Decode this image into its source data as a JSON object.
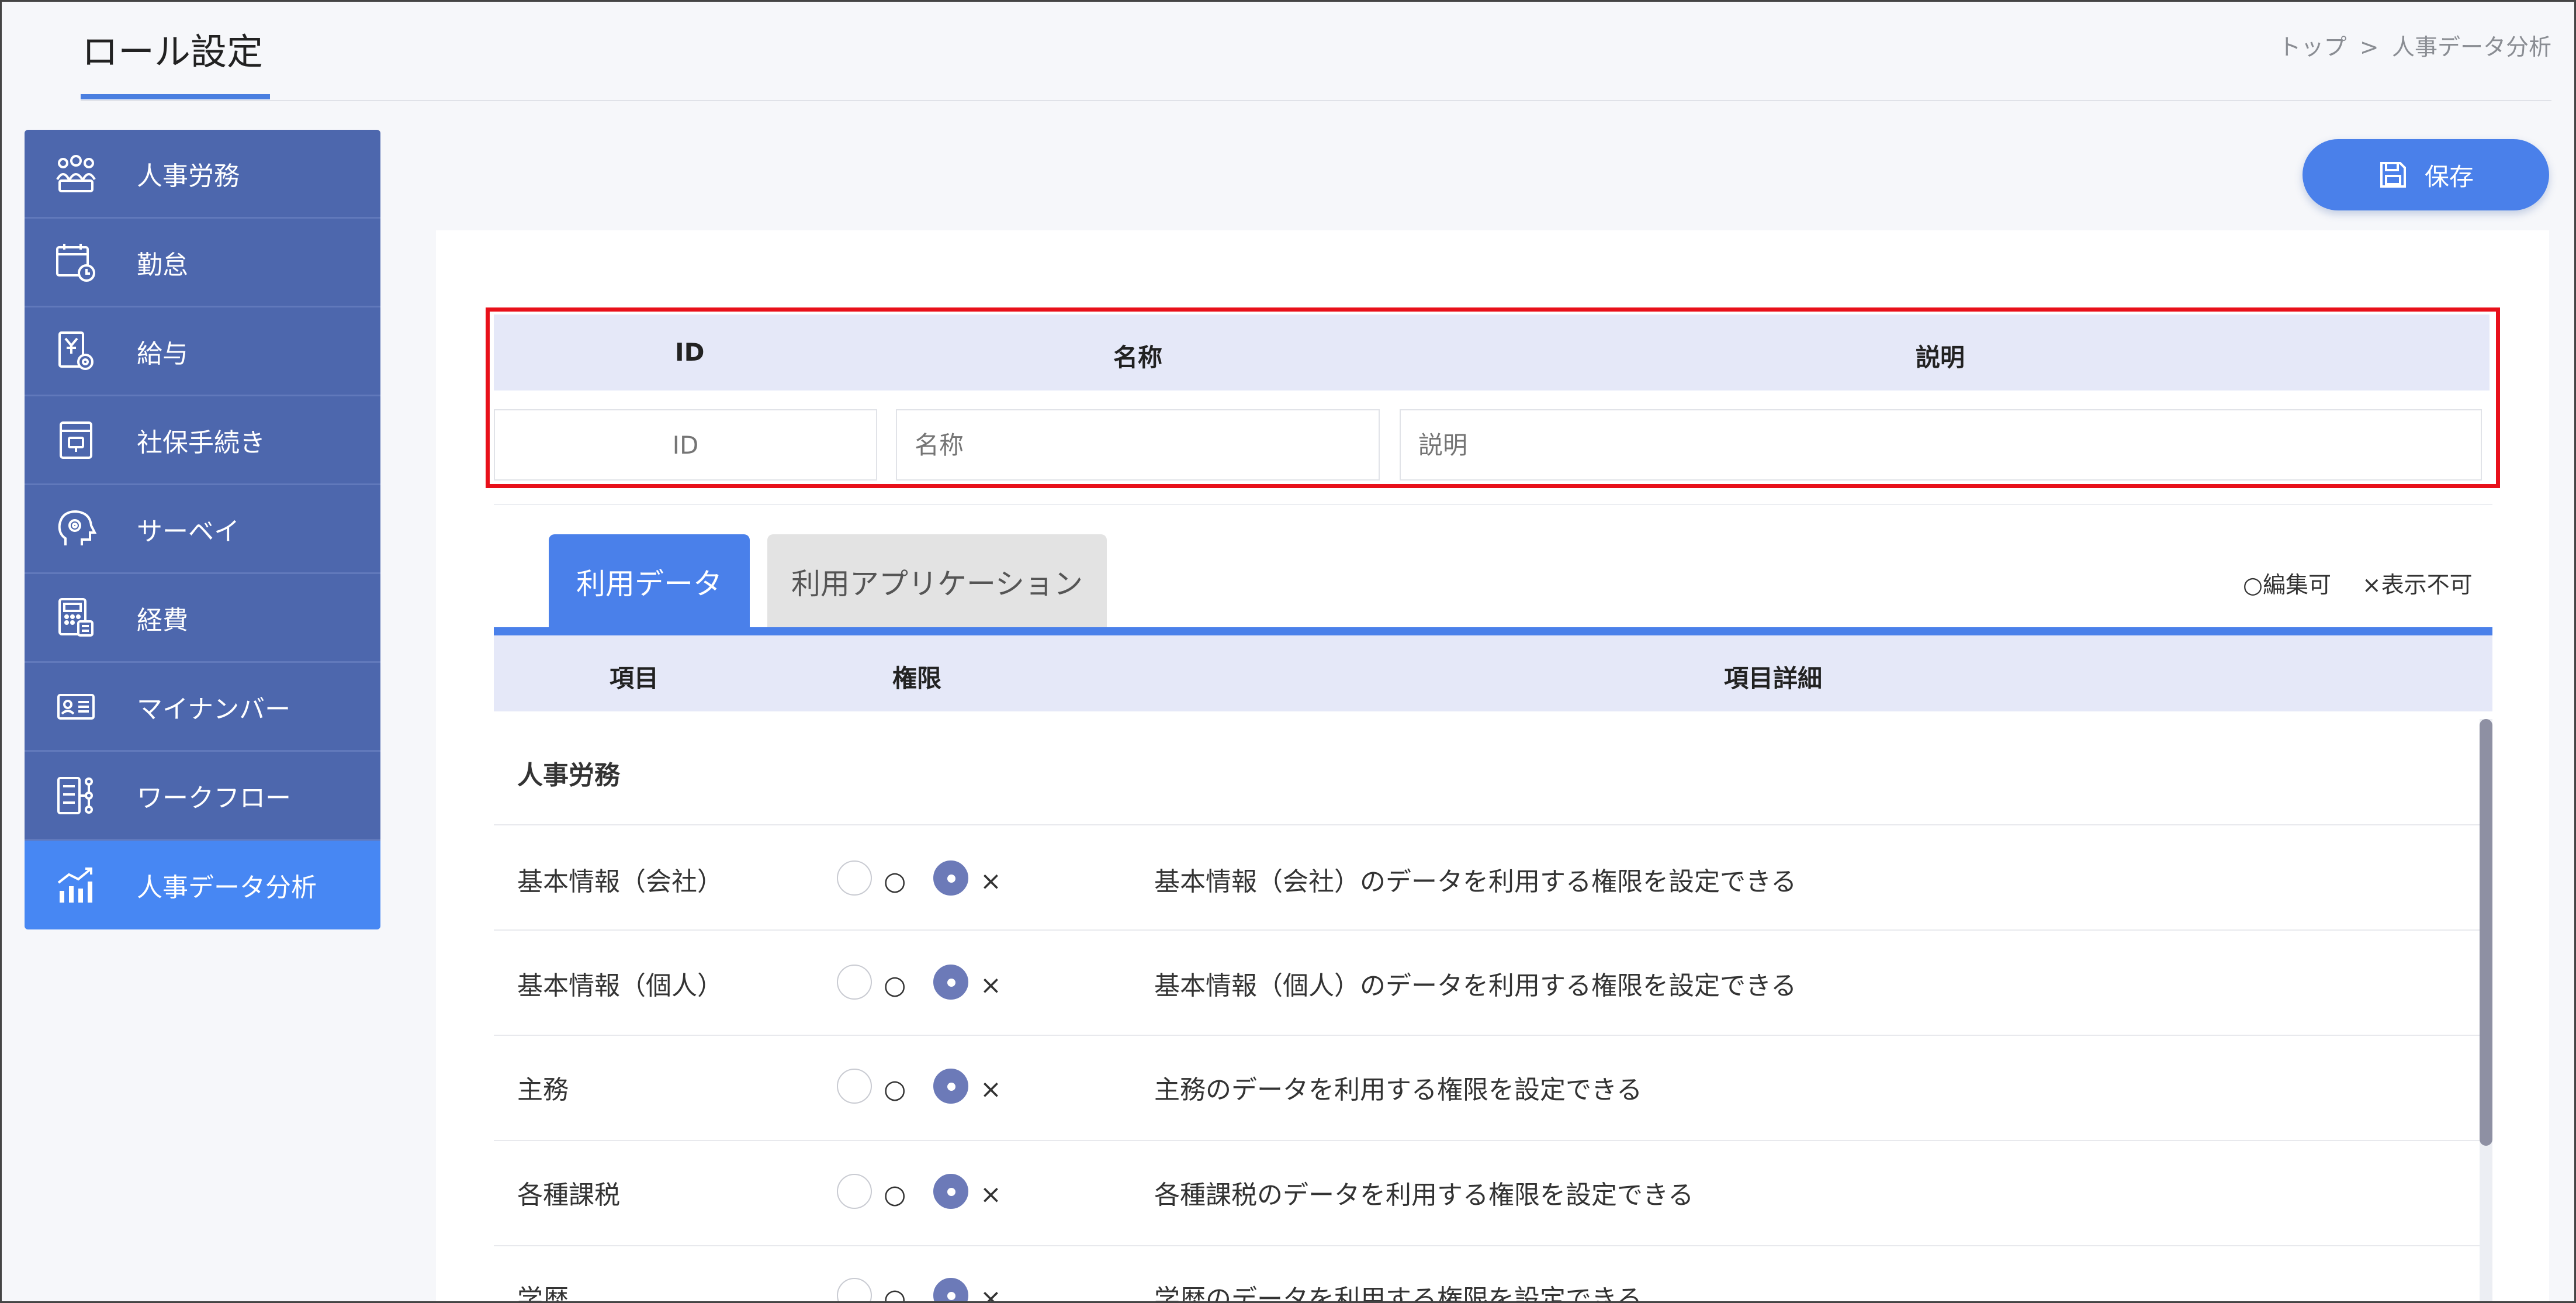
{
  "header": {
    "title": "ロール設定",
    "breadcrumb": [
      "トップ",
      ">",
      "人事データ分析"
    ]
  },
  "sidebar": {
    "items": [
      {
        "label": "人事労務",
        "icon": "people-group-icon"
      },
      {
        "label": "勤怠",
        "icon": "calendar-clock-icon"
      },
      {
        "label": "給与",
        "icon": "salary-document-icon"
      },
      {
        "label": "社保手続き",
        "icon": "insurance-file-icon"
      },
      {
        "label": "サーベイ",
        "icon": "head-gear-icon"
      },
      {
        "label": "経費",
        "icon": "calculator-icon"
      },
      {
        "label": "マイナンバー",
        "icon": "id-card-icon"
      },
      {
        "label": "ワークフロー",
        "icon": "workflow-icon"
      },
      {
        "label": "人事データ分析",
        "icon": "chart-trend-icon",
        "active": true
      }
    ]
  },
  "toolbar": {
    "save_label": "保存"
  },
  "form": {
    "headers": {
      "id": "ID",
      "name": "名称",
      "description": "説明"
    },
    "placeholders": {
      "id": "ID",
      "name": "名称",
      "description": "説明"
    }
  },
  "tabs": [
    {
      "label": "利用データ",
      "active": true
    },
    {
      "label": "利用アプリケーション",
      "active": false
    }
  ],
  "legend": {
    "editable": "○編集可",
    "hidden": "×表示不可"
  },
  "table": {
    "columns": [
      "項目",
      "権限",
      "項目詳細"
    ],
    "section": "人事労務",
    "option_yes": "○",
    "option_no": "×",
    "rows": [
      {
        "item": "基本情報（会社）",
        "selected": "no",
        "detail": "基本情報（会社）のデータを利用する権限を設定できる"
      },
      {
        "item": "基本情報（個人）",
        "selected": "no",
        "detail": "基本情報（個人）のデータを利用する権限を設定できる"
      },
      {
        "item": "主務",
        "selected": "no",
        "detail": "主務のデータを利用する権限を設定できる"
      },
      {
        "item": "各種課税",
        "selected": "no",
        "detail": "各種課税のデータを利用する権限を設定できる"
      },
      {
        "item": "学歴",
        "selected": "no",
        "detail": "学歴のデータを利用する権限を設定できる"
      }
    ]
  },
  "colors": {
    "accent": "#4a80ea",
    "sidebar": "#4d67ad",
    "sidebar_active": "#4787f3",
    "highlight": "#e8101a",
    "header_bg": "#e5e8f8"
  }
}
